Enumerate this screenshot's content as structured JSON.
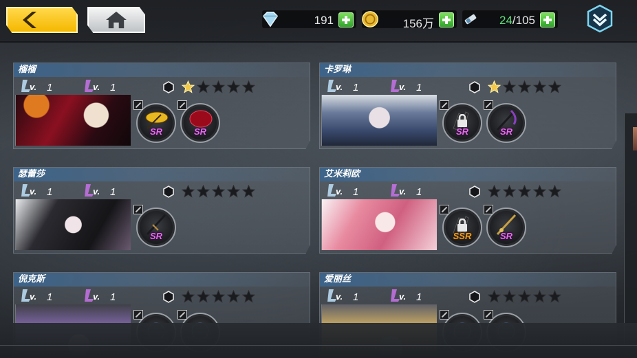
{
  "resources": {
    "diamonds": "191",
    "gold": "156万",
    "stamina_current": "24",
    "stamina_sep_max": "/105"
  },
  "icons": {
    "back": "chevron-left-icon",
    "home": "home-icon",
    "menu": "chevron-down-hex-icon",
    "add": "plus-icon"
  },
  "colors": {
    "accent_yellow": "#f5b800",
    "plus_green": "#2fa52a",
    "sr_purple": "#e070e8",
    "ssr_orange": "#f0a020",
    "star_gold": "#f2c84a"
  },
  "characters": [
    {
      "name": "榴榴",
      "level": "1",
      "skill_level": "1",
      "stars_filled": 1,
      "stars_total": 5,
      "equips": [
        {
          "rarity": "SR",
          "locked": false,
          "item": "umbrella"
        },
        {
          "rarity": "SR",
          "locked": false,
          "item": "red-orb"
        }
      ]
    },
    {
      "name": "卡罗琳",
      "level": "1",
      "skill_level": "1",
      "stars_filled": 1,
      "stars_total": 5,
      "equips": [
        {
          "rarity": "SR",
          "locked": true,
          "item": "claw"
        },
        {
          "rarity": "SR",
          "locked": false,
          "item": "scythe"
        }
      ]
    },
    {
      "name": "瑟蕾莎",
      "level": "1",
      "skill_level": "1",
      "stars_filled": 0,
      "stars_total": 5,
      "equips": [
        {
          "rarity": "SR",
          "locked": false,
          "item": "dagger"
        }
      ]
    },
    {
      "name": "艾米莉欧",
      "level": "1",
      "skill_level": "1",
      "stars_filled": 0,
      "stars_total": 5,
      "equips": [
        {
          "rarity": "SSR",
          "locked": true,
          "item": "claw"
        },
        {
          "rarity": "SR",
          "locked": false,
          "item": "sword"
        }
      ]
    },
    {
      "name": "倪克斯",
      "level": "1",
      "skill_level": "1",
      "stars_filled": 0,
      "stars_total": 5,
      "equips": [
        {
          "rarity": "",
          "locked": false,
          "item": "unknown"
        },
        {
          "rarity": "",
          "locked": false,
          "item": "unknown"
        }
      ]
    },
    {
      "name": "爱丽丝",
      "level": "1",
      "skill_level": "1",
      "stars_filled": 0,
      "stars_total": 5,
      "equips": [
        {
          "rarity": "",
          "locked": false,
          "item": "unknown"
        },
        {
          "rarity": "",
          "locked": false,
          "item": "unknown"
        }
      ]
    }
  ]
}
